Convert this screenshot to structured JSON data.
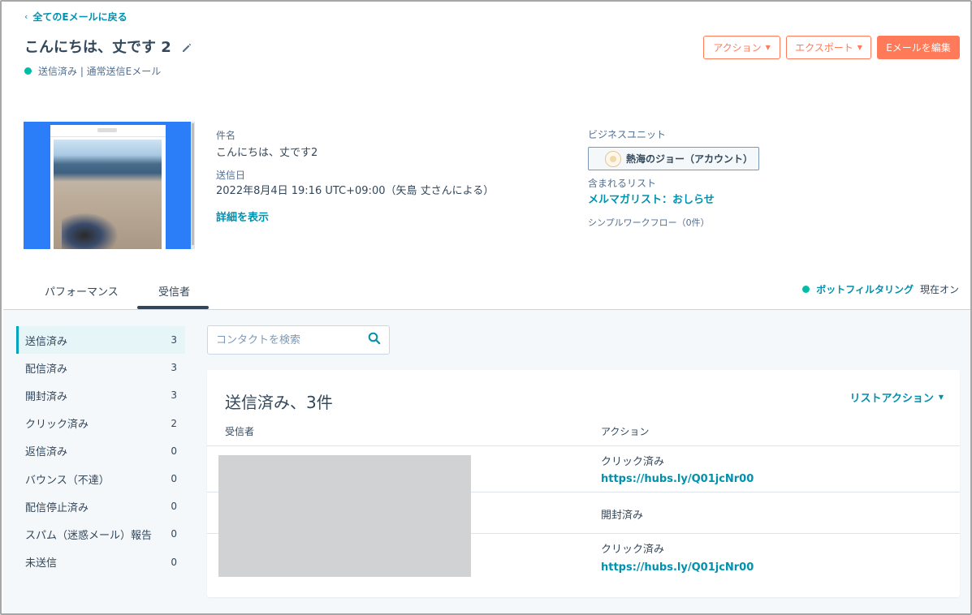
{
  "header": {
    "back_link": "全てのEメールに戻る",
    "title": "こんにちは、丈です 2",
    "status": "送信済み | 通常送信Eメール",
    "status_color": "#00bda5",
    "buttons": {
      "action": "アクション",
      "export": "エクスポート",
      "edit": "Eメールを編集"
    }
  },
  "details": {
    "subject_label": "件名",
    "subject_value": "こんにちは、丈です2",
    "sent_label": "送信日",
    "sent_value": "2022年8月4日 19:16 UTC+09:00（矢島 丈さんによる）",
    "show_details": "詳細を表示",
    "business_unit_label": "ビジネスユニット",
    "business_unit_value": "熱海のジョー（アカウント）",
    "included_list_label": "含まれるリスト",
    "included_list_value": "メルマガリスト：おしらせ",
    "workflow_label": "シンプルワークフロー（0件）"
  },
  "tabs": [
    {
      "label": "パフォーマンス",
      "active": false
    },
    {
      "label": "受信者",
      "active": true
    }
  ],
  "bot_filter": {
    "label": "ボットフィルタリング",
    "state": "現在オン"
  },
  "sidebar": {
    "items": [
      {
        "label": "送信済み",
        "count": "3",
        "active": true
      },
      {
        "label": "配信済み",
        "count": "3"
      },
      {
        "label": "開封済み",
        "count": "3"
      },
      {
        "label": "クリック済み",
        "count": "2"
      },
      {
        "label": "返信済み",
        "count": "0"
      },
      {
        "label": "バウンス（不達）",
        "count": "0"
      },
      {
        "label": "配信停止済み",
        "count": "0"
      },
      {
        "label": "スパム（迷惑メール）報告",
        "count": "0"
      },
      {
        "label": "未送信",
        "count": "0"
      }
    ]
  },
  "search": {
    "placeholder": "コンタクトを検索"
  },
  "card": {
    "title": "送信済み、3件",
    "list_action": "リストアクション",
    "columns": [
      "受信者",
      "アクション"
    ],
    "rows": [
      {
        "action": "クリック済み",
        "link": "https://hubs.ly/Q01jcNr00"
      },
      {
        "action": "開封済み"
      },
      {
        "action": "クリック済み",
        "link": "https://hubs.ly/Q01jcNr00"
      }
    ]
  },
  "colors": {
    "accent": "#ff7a59",
    "link": "#0091ae",
    "text": "#33475b",
    "active_tab_indicator": "#33475b"
  }
}
